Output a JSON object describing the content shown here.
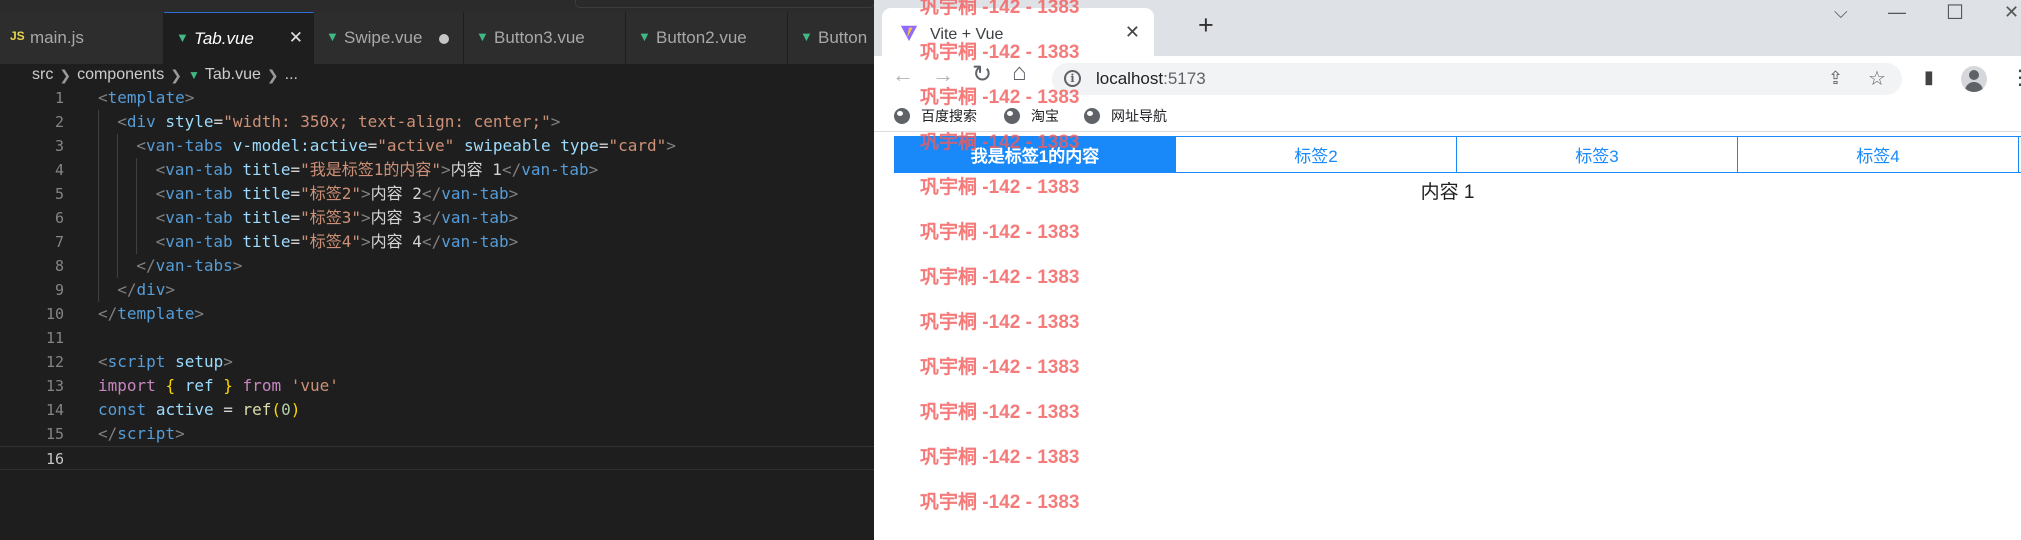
{
  "editor": {
    "tabs": [
      {
        "name": "main.js",
        "icon": "JS",
        "type": "js",
        "width": 164,
        "active": false,
        "dirty": false
      },
      {
        "name": "Tab.vue",
        "icon": "▼",
        "type": "vue",
        "width": 150,
        "active": true,
        "dirty": false,
        "close": "✕"
      },
      {
        "name": "Swipe.vue",
        "icon": "▼",
        "type": "vue",
        "width": 150,
        "active": false,
        "dirty": true
      },
      {
        "name": "Button3.vue",
        "icon": "▼",
        "type": "vue",
        "width": 162,
        "active": false,
        "dirty": false
      },
      {
        "name": "Button2.vue",
        "icon": "▼",
        "type": "vue",
        "width": 162,
        "active": false,
        "dirty": false
      },
      {
        "name": "Button",
        "icon": "▼",
        "type": "vue",
        "width": 100,
        "active": false,
        "dirty": false
      }
    ],
    "breadcrumb": {
      "parts": [
        "src",
        "components"
      ],
      "file": "Tab.vue",
      "tail": "..."
    },
    "current_line": 16,
    "lines": [
      {
        "n": "1",
        "indent": 0,
        "tokens": [
          [
            "p",
            "<"
          ],
          [
            "t",
            "template"
          ],
          [
            "p",
            ">"
          ]
        ]
      },
      {
        "n": "2",
        "indent": 1,
        "tokens": [
          [
            "p",
            "<"
          ],
          [
            "t",
            "div"
          ],
          [
            "d",
            " "
          ],
          [
            "a",
            "style"
          ],
          [
            "d",
            "="
          ],
          [
            "s",
            "\"width: 350x; text-align: center;\""
          ],
          [
            "p",
            ">"
          ]
        ]
      },
      {
        "n": "3",
        "indent": 2,
        "tokens": [
          [
            "p",
            "<"
          ],
          [
            "t",
            "van-tabs"
          ],
          [
            "d",
            " "
          ],
          [
            "a",
            "v-model:active"
          ],
          [
            "d",
            "="
          ],
          [
            "s",
            "\"active\""
          ],
          [
            "d",
            " "
          ],
          [
            "a",
            "swipeable"
          ],
          [
            "d",
            " "
          ],
          [
            "a",
            "type"
          ],
          [
            "d",
            "="
          ],
          [
            "s",
            "\"card\""
          ],
          [
            "p",
            ">"
          ]
        ]
      },
      {
        "n": "4",
        "indent": 3,
        "tokens": [
          [
            "p",
            "<"
          ],
          [
            "t",
            "van-tab"
          ],
          [
            "d",
            " "
          ],
          [
            "a",
            "title"
          ],
          [
            "d",
            "="
          ],
          [
            "s",
            "\"我是标签1的内容\""
          ],
          [
            "p",
            ">"
          ],
          [
            "d",
            "内容 1"
          ],
          [
            "p",
            "</"
          ],
          [
            "t",
            "van-tab"
          ],
          [
            "p",
            ">"
          ]
        ]
      },
      {
        "n": "5",
        "indent": 3,
        "tokens": [
          [
            "p",
            "<"
          ],
          [
            "t",
            "van-tab"
          ],
          [
            "d",
            " "
          ],
          [
            "a",
            "title"
          ],
          [
            "d",
            "="
          ],
          [
            "s",
            "\"标签2\""
          ],
          [
            "p",
            ">"
          ],
          [
            "d",
            "内容 2"
          ],
          [
            "p",
            "</"
          ],
          [
            "t",
            "van-tab"
          ],
          [
            "p",
            ">"
          ]
        ]
      },
      {
        "n": "6",
        "indent": 3,
        "tokens": [
          [
            "p",
            "<"
          ],
          [
            "t",
            "van-tab"
          ],
          [
            "d",
            " "
          ],
          [
            "a",
            "title"
          ],
          [
            "d",
            "="
          ],
          [
            "s",
            "\"标签3\""
          ],
          [
            "p",
            ">"
          ],
          [
            "d",
            "内容 3"
          ],
          [
            "p",
            "</"
          ],
          [
            "t",
            "van-tab"
          ],
          [
            "p",
            ">"
          ]
        ]
      },
      {
        "n": "7",
        "indent": 3,
        "tokens": [
          [
            "p",
            "<"
          ],
          [
            "t",
            "van-tab"
          ],
          [
            "d",
            " "
          ],
          [
            "a",
            "title"
          ],
          [
            "d",
            "="
          ],
          [
            "s",
            "\"标签4\""
          ],
          [
            "p",
            ">"
          ],
          [
            "d",
            "内容 4"
          ],
          [
            "p",
            "</"
          ],
          [
            "t",
            "van-tab"
          ],
          [
            "p",
            ">"
          ]
        ]
      },
      {
        "n": "8",
        "indent": 2,
        "tokens": [
          [
            "p",
            "</"
          ],
          [
            "t",
            "van-tabs"
          ],
          [
            "p",
            ">"
          ]
        ]
      },
      {
        "n": "9",
        "indent": 1,
        "tokens": [
          [
            "p",
            "</"
          ],
          [
            "t",
            "div"
          ],
          [
            "p",
            ">"
          ]
        ]
      },
      {
        "n": "10",
        "indent": 0,
        "tokens": [
          [
            "p",
            "</"
          ],
          [
            "t",
            "template"
          ],
          [
            "p",
            ">"
          ]
        ]
      },
      {
        "n": "11",
        "indent": 0,
        "tokens": []
      },
      {
        "n": "12",
        "indent": 0,
        "tokens": [
          [
            "p",
            "<"
          ],
          [
            "t",
            "script"
          ],
          [
            "d",
            " "
          ],
          [
            "a",
            "setup"
          ],
          [
            "p",
            ">"
          ]
        ]
      },
      {
        "n": "13",
        "indent": 0,
        "tokens": [
          [
            "k",
            "import"
          ],
          [
            "d",
            " "
          ],
          [
            "b",
            "{"
          ],
          [
            "d",
            " "
          ],
          [
            "v",
            "ref"
          ],
          [
            "d",
            " "
          ],
          [
            "b",
            "}"
          ],
          [
            "d",
            " "
          ],
          [
            "k",
            "from"
          ],
          [
            "d",
            " "
          ],
          [
            "s",
            "'vue'"
          ]
        ]
      },
      {
        "n": "14",
        "indent": 0,
        "tokens": [
          [
            "c",
            "const"
          ],
          [
            "d",
            " "
          ],
          [
            "v",
            "active"
          ],
          [
            "d",
            " = "
          ],
          [
            "f",
            "ref"
          ],
          [
            "b",
            "("
          ],
          [
            "n",
            "0"
          ],
          [
            "b",
            ")"
          ]
        ]
      },
      {
        "n": "15",
        "indent": 0,
        "tokens": [
          [
            "p",
            "</"
          ],
          [
            "t",
            "script"
          ],
          [
            "p",
            ">"
          ]
        ]
      },
      {
        "n": "16",
        "indent": 0,
        "tokens": []
      }
    ]
  },
  "browser": {
    "tab_title": "Vite + Vue",
    "tab_close": "✕",
    "newtab": "+",
    "window_controls": {
      "chevron": "⌵",
      "minimize": "—",
      "maximize": "☐",
      "close": "✕"
    },
    "nav": {
      "back": "←",
      "forward": "→",
      "reload": "↻",
      "home": "⌂"
    },
    "url_host": "localhost",
    "url_port": ":5173",
    "info_glyph": "i",
    "share_glyph": "⇪",
    "star_glyph": "☆",
    "sidepanel_glyph": "▮",
    "menu_glyph": "⋮",
    "bookmarks": [
      "百度搜索",
      "淘宝",
      "网址导航"
    ],
    "tabs": [
      {
        "title": "我是标签1的内容",
        "active": true
      },
      {
        "title": "标签2",
        "active": false
      },
      {
        "title": "标签3",
        "active": false
      },
      {
        "title": "标签4",
        "active": false
      }
    ],
    "content": "内容 1",
    "watermark": "巩宇桐 -142 - 1383",
    "watermark_count": 12
  },
  "colors": {
    "vant_blue": "#1989fa",
    "watermark": "#f25a5a",
    "vue_green": "#41b883"
  }
}
